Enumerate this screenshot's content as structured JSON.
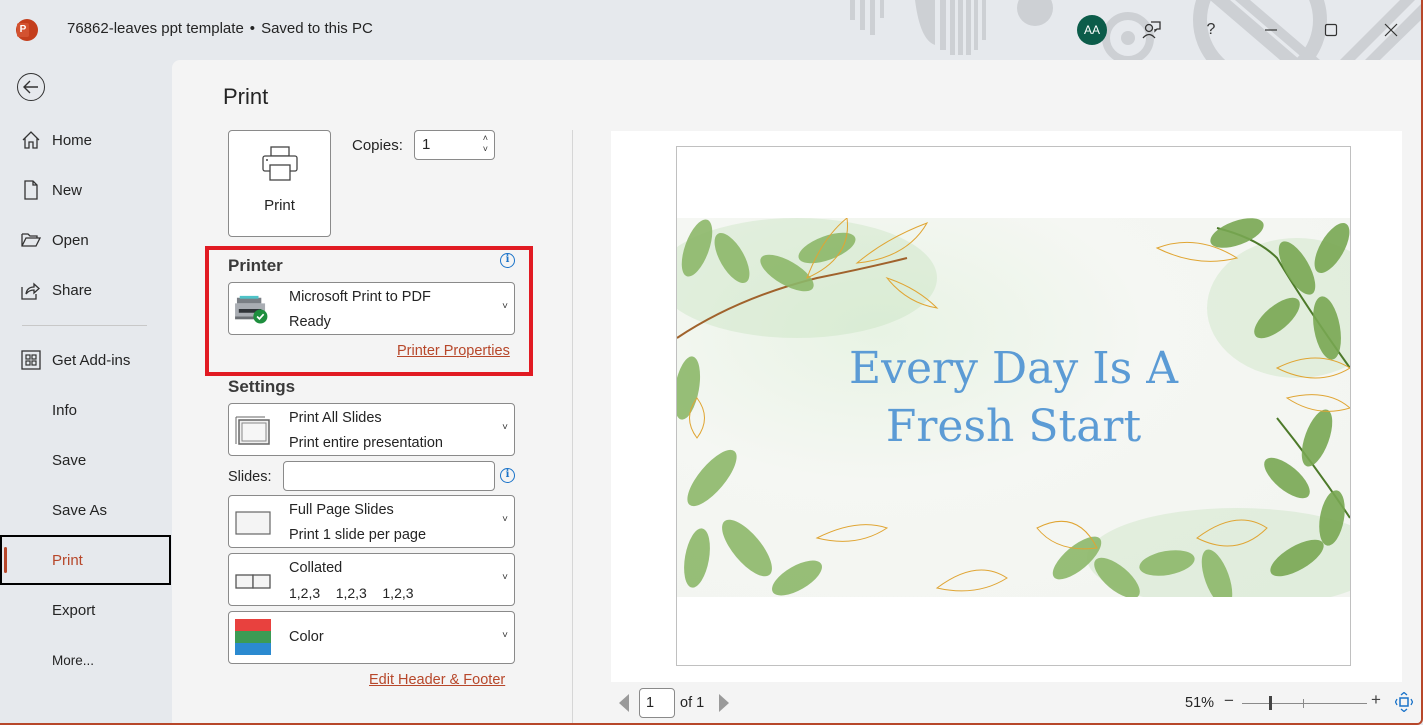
{
  "titlebar": {
    "app_icon": "powerpoint-icon",
    "document_name": "76862-leaves ppt template",
    "separator": "•",
    "save_status": "Saved to this PC",
    "avatar_initials": "AA",
    "buttons": [
      "share-comment-icon",
      "help-icon",
      "minimize-icon",
      "maximize-icon",
      "close-icon"
    ],
    "help_label": "?"
  },
  "sidebar": {
    "back_icon": "back-arrow-icon",
    "items": [
      {
        "label": "Home",
        "icon": "home-icon"
      },
      {
        "label": "New",
        "icon": "new-document-icon"
      },
      {
        "label": "Open",
        "icon": "folder-open-icon"
      },
      {
        "label": "Share",
        "icon": "share-icon"
      },
      {
        "label": "Get Add-ins",
        "icon": "add-ins-grid-icon"
      },
      {
        "label": "Info"
      },
      {
        "label": "Save"
      },
      {
        "label": "Save As"
      },
      {
        "label": "Print",
        "active": true
      },
      {
        "label": "Export"
      },
      {
        "label": "More..."
      }
    ]
  },
  "print": {
    "page_title": "Print",
    "print_button_label": "Print",
    "copies_label": "Copies:",
    "copies_value": "1",
    "printer": {
      "section_title": "Printer",
      "name": "Microsoft Print to PDF",
      "status": "Ready",
      "properties_link": "Printer Properties"
    },
    "settings": {
      "section_title": "Settings",
      "range": {
        "title": "Print All Slides",
        "subtitle": "Print entire presentation"
      },
      "slides_label": "Slides:",
      "slides_value": "",
      "layout": {
        "title": "Full Page Slides",
        "subtitle": "Print 1 slide per page"
      },
      "collation": {
        "title": "Collated",
        "subtitle": "1,2,3    1,2,3    1,2,3"
      },
      "color": {
        "title": "Color"
      },
      "header_footer_link": "Edit Header & Footer"
    }
  },
  "preview": {
    "slide_title_line1": "Every Day Is A",
    "slide_title_line2": "Fresh Start",
    "current_page": "1",
    "of_pages": "of 1",
    "zoom_percent": "51%",
    "zoom_minus": "−",
    "zoom_plus": "+",
    "zoom_level": 0.51
  },
  "colors": {
    "accent": "#b7472a",
    "highlight_box": "#e11a22",
    "info_blue": "#1a73c9",
    "slide_title": "#5b9bd5",
    "avatar_bg": "#0c5c4a"
  }
}
